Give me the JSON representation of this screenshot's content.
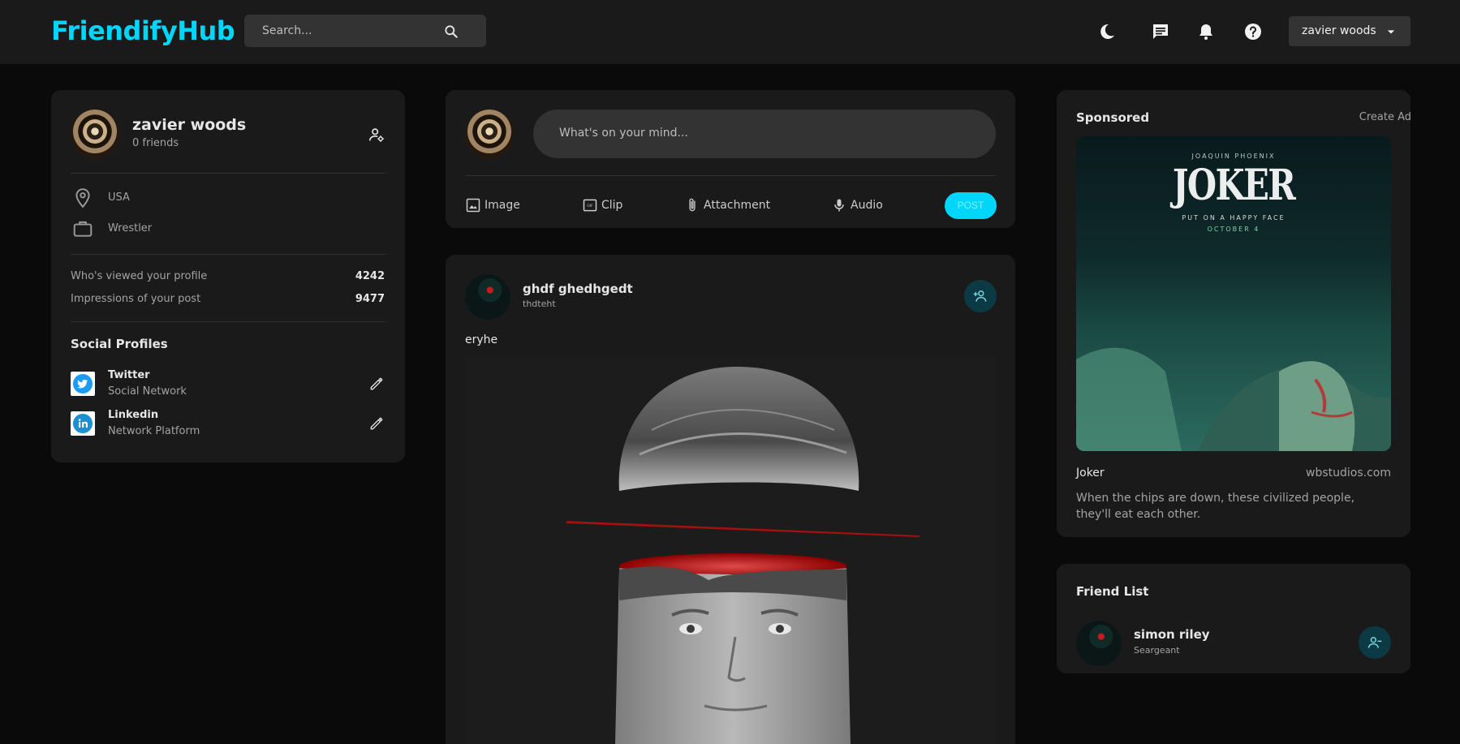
{
  "brand": {
    "name": "FriendifyHub"
  },
  "navbar": {
    "search_placeholder": "Search...",
    "icons": [
      "search-icon",
      "dark-mode-icon",
      "message-icon",
      "notification-icon",
      "help-icon"
    ],
    "user_select": {
      "selected": "zavier woods"
    }
  },
  "profile": {
    "name": "zavier woods",
    "friends": "0 friends",
    "location": "USA",
    "occupation": "Wrestler",
    "stats": [
      {
        "label": "Who's viewed your profile",
        "value": "4242"
      },
      {
        "label": "Impressions of your post",
        "value": "9477"
      }
    ],
    "social_title": "Social Profiles",
    "social": [
      {
        "name": "Twitter",
        "type": "Social Network",
        "icon": "twitter-icon",
        "color": "#1d9bf0"
      },
      {
        "name": "Linkedin",
        "type": "Network Platform",
        "icon": "linkedin-icon",
        "color": "#1c8fd1"
      }
    ]
  },
  "composer": {
    "placeholder": "What's on your mind...",
    "actions": [
      {
        "label": "Image",
        "icon": "image-icon"
      },
      {
        "label": "Clip",
        "icon": "gif-icon"
      },
      {
        "label": "Attachment",
        "icon": "attachment-icon"
      },
      {
        "label": "Audio",
        "icon": "microphone-icon"
      }
    ],
    "post_label": "POST"
  },
  "post": {
    "author": "ghdf ghedhgedt",
    "location": "thdteht",
    "text": "eryhe"
  },
  "sponsored": {
    "title": "Sponsored",
    "create_ad": "Create Ad",
    "poster": {
      "top": "JOAQUIN PHOENIX",
      "title": "JOKER",
      "tagline": "PUT ON A HAPPY FACE",
      "date": "OCTOBER 4"
    },
    "name": "Joker",
    "site": "wbstudios.com",
    "description": "When the chips are down, these civilized people, they'll eat each other."
  },
  "friend_list": {
    "title": "Friend List",
    "friends": [
      {
        "name": "simon riley",
        "subtitle": "Seargeant"
      }
    ]
  },
  "colors": {
    "accent": "#00d5fa",
    "background": "#0a0a0a",
    "surface": "#1a1a1a",
    "input": "#333333",
    "friend_button": "#0b3a44"
  }
}
